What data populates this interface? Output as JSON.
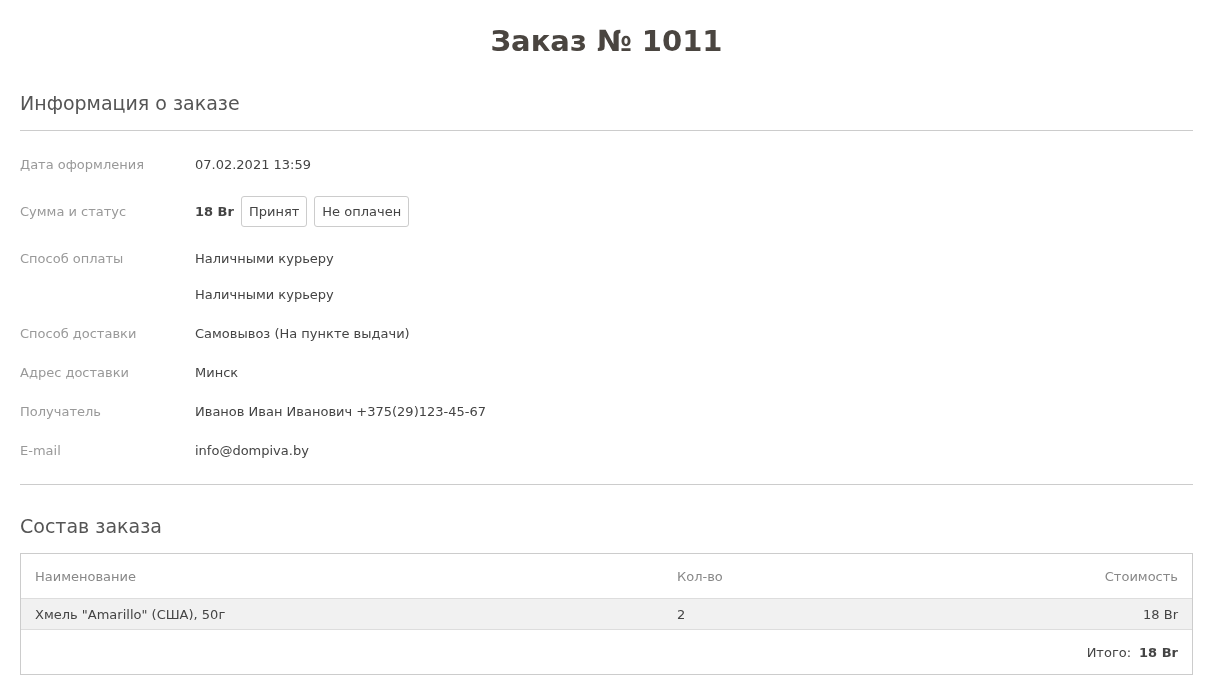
{
  "title": "Заказ № 1011",
  "info": {
    "heading": "Информация о заказе",
    "rows": [
      {
        "kind": "text",
        "label": "Дата оформления",
        "value": "07.02.2021 13:59"
      },
      {
        "kind": "status",
        "label": "Сумма и статус",
        "amount": "18 Br",
        "badges": [
          "Принят",
          "Не оплачен"
        ]
      },
      {
        "kind": "text",
        "label": "Способ оплаты",
        "value": "Наличными курьеру"
      },
      {
        "kind": "text",
        "value": "Наличными курьеру"
      },
      {
        "kind": "text",
        "label": "Способ доставки",
        "value": "Самовывоз (На пункте выдачи)"
      },
      {
        "kind": "text",
        "label": "Адрес доставки",
        "value": "Минск"
      },
      {
        "kind": "text",
        "label": "Получатель",
        "value": "Иванов Иван Иванович +375(29)123-45-67"
      },
      {
        "kind": "text",
        "label": "E-mail",
        "value": "info@dompiva.by"
      }
    ]
  },
  "items": {
    "heading": "Состав заказа",
    "columns": [
      "Наименование",
      "Кол-во",
      "Стоимость"
    ],
    "rows": [
      [
        "Хмель \"Amarillo\" (США), 50г",
        "2",
        "18 Br"
      ]
    ],
    "total_label": "Итого:",
    "total_value": "18 Br"
  }
}
